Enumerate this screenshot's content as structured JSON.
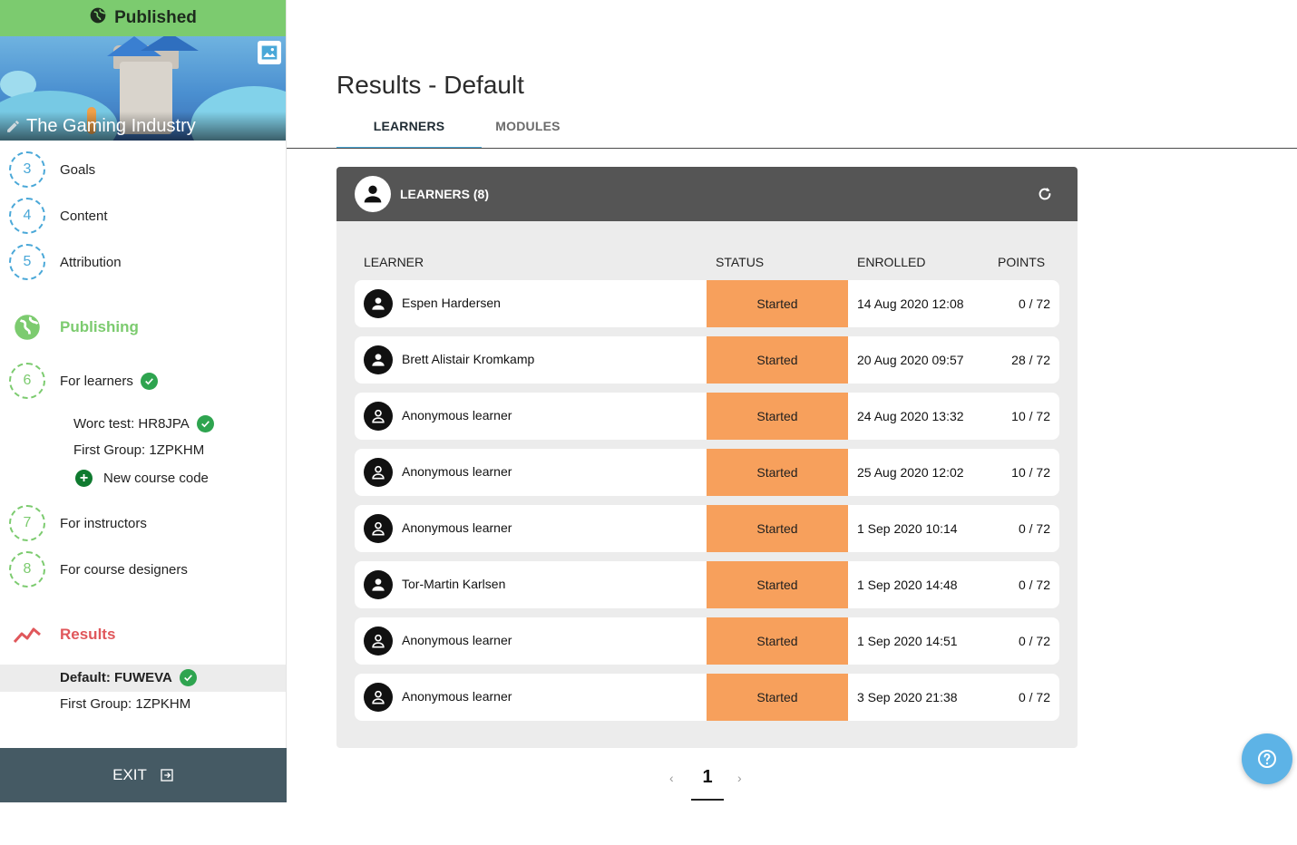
{
  "sidebar": {
    "status_banner": "Published",
    "course_title": "The Gaming Industry",
    "steps_top": [
      {
        "number": "3",
        "label": "Goals"
      },
      {
        "number": "4",
        "label": "Content"
      },
      {
        "number": "5",
        "label": "Attribution"
      }
    ],
    "publishing": {
      "heading": "Publishing",
      "for_learners": {
        "number": "6",
        "label": "For learners"
      },
      "codes": [
        {
          "label": "Worc test: HR8JPA",
          "verified": true
        },
        {
          "label": "First Group: 1ZPKHM",
          "verified": false
        }
      ],
      "new_code_label": "New course code",
      "for_instructors": {
        "number": "7",
        "label": "For instructors"
      },
      "for_designers": {
        "number": "8",
        "label": "For course designers"
      }
    },
    "results": {
      "heading": "Results",
      "items": [
        {
          "label": "Default: FUWEVA",
          "active": true,
          "verified": true
        },
        {
          "label": "First Group: 1ZPKHM",
          "active": false,
          "verified": false
        }
      ]
    },
    "exit_label": "EXIT"
  },
  "main": {
    "title": "Results - Default",
    "tabs": [
      {
        "label": "LEARNERS",
        "active": true
      },
      {
        "label": "MODULES",
        "active": false
      }
    ],
    "panel": {
      "title": "LEARNERS (8)",
      "columns": {
        "learner": "LEARNER",
        "status": "STATUS",
        "enrolled": "ENROLLED",
        "points": "POINTS"
      },
      "rows": [
        {
          "name": "Espen Hardersen",
          "status": "Started",
          "enrolled": "14 Aug 2020 12:08",
          "points": "0 / 72",
          "anonymous": false
        },
        {
          "name": "Brett Alistair Kromkamp",
          "status": "Started",
          "enrolled": "20 Aug 2020 09:57",
          "points": "28 / 72",
          "anonymous": false
        },
        {
          "name": "Anonymous learner",
          "status": "Started",
          "enrolled": "24 Aug 2020 13:32",
          "points": "10 / 72",
          "anonymous": true
        },
        {
          "name": "Anonymous learner",
          "status": "Started",
          "enrolled": "25 Aug 2020 12:02",
          "points": "10 / 72",
          "anonymous": true
        },
        {
          "name": "Anonymous learner",
          "status": "Started",
          "enrolled": "1 Sep 2020 10:14",
          "points": "0 / 72",
          "anonymous": true
        },
        {
          "name": "Tor-Martin Karlsen",
          "status": "Started",
          "enrolled": "1 Sep 2020 14:48",
          "points": "0 / 72",
          "anonymous": false
        },
        {
          "name": "Anonymous learner",
          "status": "Started",
          "enrolled": "1 Sep 2020 14:51",
          "points": "0 / 72",
          "anonymous": true
        },
        {
          "name": "Anonymous learner",
          "status": "Started",
          "enrolled": "3 Sep 2020 21:38",
          "points": "0 / 72",
          "anonymous": true
        }
      ]
    },
    "pagination": {
      "prev": "‹",
      "current": "1",
      "next": "›"
    }
  },
  "colors": {
    "published_green": "#7ccb6f",
    "step_blue": "#4aa8d8",
    "results_red": "#e0575b",
    "status_orange": "#f7a05c",
    "exit_bar": "#455a64",
    "panel_header": "#555555"
  },
  "icons": {
    "banner": "globe-icon",
    "cover_image": "image-icon",
    "edit": "pencil-icon",
    "publishing": "globe-icon",
    "results": "trend-line-icon",
    "verified": "check-circle-icon",
    "add": "plus-circle-icon",
    "exit": "exit-icon",
    "refresh": "refresh-icon",
    "learner": "person-icon",
    "help": "question-icon"
  }
}
